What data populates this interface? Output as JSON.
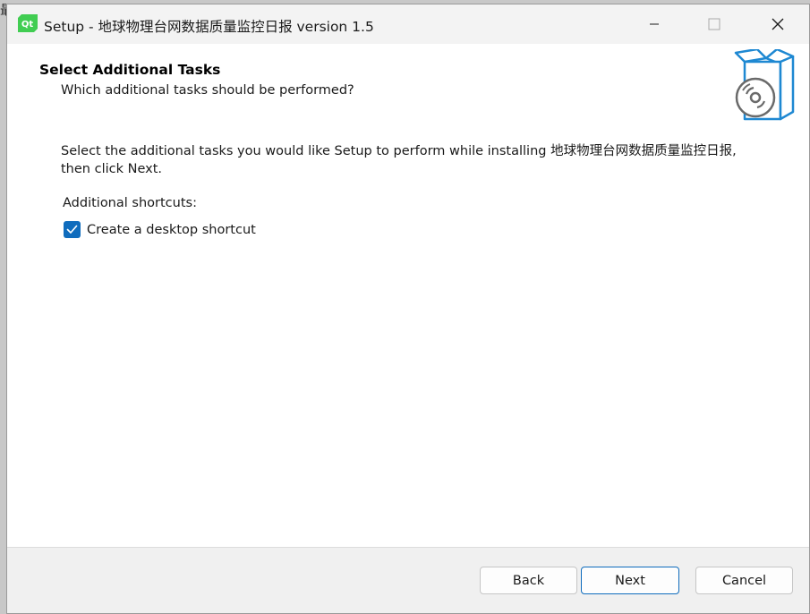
{
  "window": {
    "title": "Setup - 地球物理台网数据质量监控日报 version 1.5",
    "app_icon_text": "Qt",
    "accent_color": "#0f6cbd"
  },
  "page": {
    "heading": "Select Additional Tasks",
    "subheading": "Which additional tasks should be performed?",
    "description": "Select the additional tasks you would like Setup to perform while installing 地球物理台网数据质量监控日报, then click Next.",
    "shortcuts_label": "Additional shortcuts:",
    "desktop_shortcut": {
      "label": "Create a desktop shortcut",
      "checked": true
    }
  },
  "buttons": {
    "back": "Back",
    "next": "Next",
    "cancel": "Cancel"
  },
  "background_fragment": "最"
}
